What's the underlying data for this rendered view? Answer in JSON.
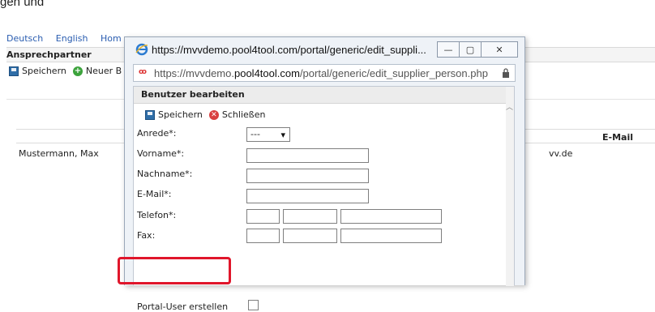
{
  "doc_fragment": "gen und",
  "background": {
    "languages": [
      "Deutsch",
      "English",
      "Hom"
    ],
    "section_title": "Ansprechpartner",
    "toolbar": {
      "save_label": "Speichern",
      "new_label": "Neuer B"
    },
    "table": {
      "email_header": "E-Mail"
    },
    "rows": [
      {
        "name": "Mustermann, Max",
        "email_fragment": "vv.de"
      }
    ]
  },
  "popup": {
    "title": "https://mvvdemo.pool4tool.com/portal/generic/edit_suppli...",
    "window_buttons": {
      "minimize": "—",
      "maximize": "▢",
      "close": "✕"
    },
    "address": {
      "prefix": "https://mvvdemo.",
      "domain": "pool4tool.com",
      "path": "/portal/generic/edit_supplier_person.php"
    },
    "form": {
      "title": "Benutzer bearbeiten",
      "save_label": "Speichern",
      "close_label": "Schließen",
      "anrede": {
        "label": "Anrede*:",
        "value": "---"
      },
      "vorname": {
        "label": "Vorname*:",
        "value": ""
      },
      "nachname": {
        "label": "Nachname*:",
        "value": ""
      },
      "email": {
        "label": "E-Mail*:",
        "value": ""
      },
      "telefon": {
        "label": "Telefon*:",
        "values": [
          "",
          "",
          ""
        ]
      },
      "fax": {
        "label": "Fax:",
        "values": [
          "",
          "",
          ""
        ]
      },
      "portal_user": {
        "label": "Portal-User erstellen",
        "checked": false
      }
    }
  },
  "colors": {
    "highlight": "#e0162b",
    "link": "#2a5db0"
  }
}
